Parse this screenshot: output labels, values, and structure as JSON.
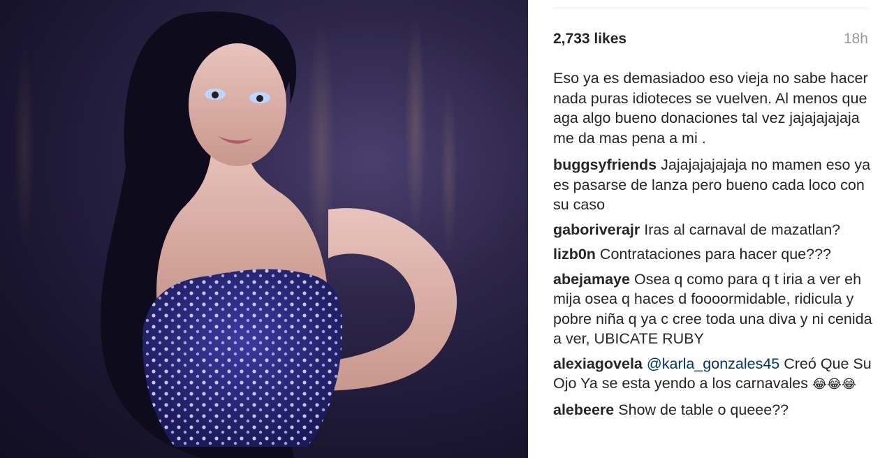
{
  "post": {
    "likes": "2,733 likes",
    "time": "18h",
    "caption": "Eso ya es demasiadoo eso vieja no sabe hacer nada puras idioteces se vuelven. Al menos que aga algo bueno donaciones tal vez jajajajajaja me da mas pena a mi ."
  },
  "comments": [
    {
      "user": "buggsyfriends",
      "text": "Jajajajajajaja no mamen eso ya es pasarse de lanza pero bueno cada loco con su caso"
    },
    {
      "user": "gaboriverajr",
      "text": "Iras al carnaval de mazatlan?"
    },
    {
      "user": "lizb0n",
      "text": "Contrataciones para hacer que???"
    },
    {
      "user": "abejamaye",
      "text": "Osea q como para q t iria a ver eh mija osea q haces d foooormidable, ridicula y pobre niña q ya c cree toda una diva y ni cenida a ver, UBICATE RUBY"
    },
    {
      "user": "alexiagovela",
      "mention": "@karla_gonzales45",
      "text": "Creó Que Su Ojo Ya se esta yendo a los carnavales",
      "emoji": "😂😂😂"
    },
    {
      "user": "alebeere",
      "text": "Show de table o queee??"
    }
  ]
}
